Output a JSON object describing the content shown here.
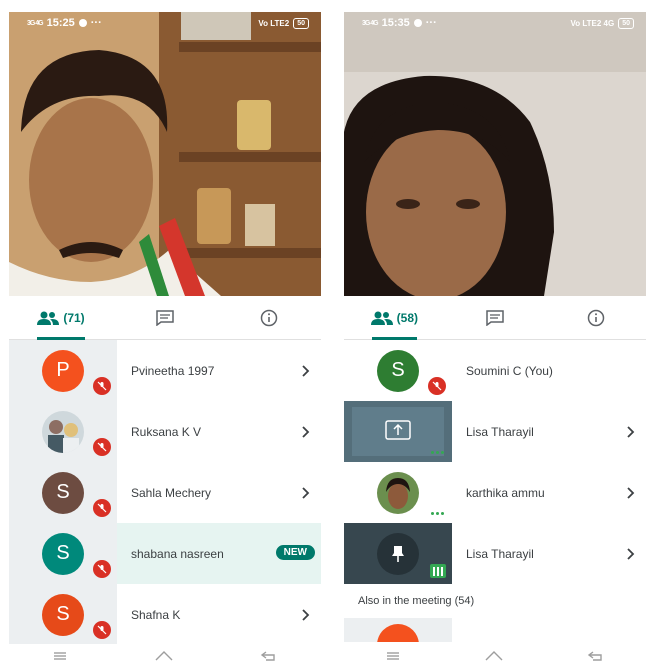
{
  "colors": {
    "accent": "#00796b",
    "mic_off": "#d93025",
    "active_green": "#34a853"
  },
  "left": {
    "status": {
      "time": "15:25",
      "signal": "3G 4G",
      "carrier": "Vo LTE2",
      "battery": "50"
    },
    "tabs": {
      "people_count": "(71)"
    },
    "participants": [
      {
        "initial": "P",
        "color": "#f4511e",
        "name": "Pvineetha 1997",
        "muted": true
      },
      {
        "initial": "",
        "color": "#90a4ae",
        "name": "Ruksana K V",
        "muted": true,
        "photo": true
      },
      {
        "initial": "S",
        "color": "#6d4c41",
        "name": "Sahla Mechery",
        "muted": true
      },
      {
        "initial": "S",
        "color": "#00897b",
        "name": "shabana nasreen",
        "muted": true,
        "badge": "NEW"
      },
      {
        "initial": "S",
        "color": "#e64a19",
        "name": "Shafna K",
        "muted": true
      }
    ]
  },
  "right": {
    "status": {
      "time": "15:35",
      "signal": "3G 4G",
      "carrier": "Vo LTE2 4G",
      "battery": "50"
    },
    "tabs": {
      "people_count": "(58)"
    },
    "participants": [
      {
        "initial": "S",
        "color": "#2e7d32",
        "name": "Soumini C (You)",
        "muted": true
      },
      {
        "name": "Lisa Tharayil",
        "kind": "screen-share"
      },
      {
        "name": "karthika ammu",
        "kind": "photo"
      },
      {
        "name": "Lisa Tharayil",
        "kind": "pin"
      }
    ],
    "also_in_meeting": "Also in the meeting (54)"
  }
}
